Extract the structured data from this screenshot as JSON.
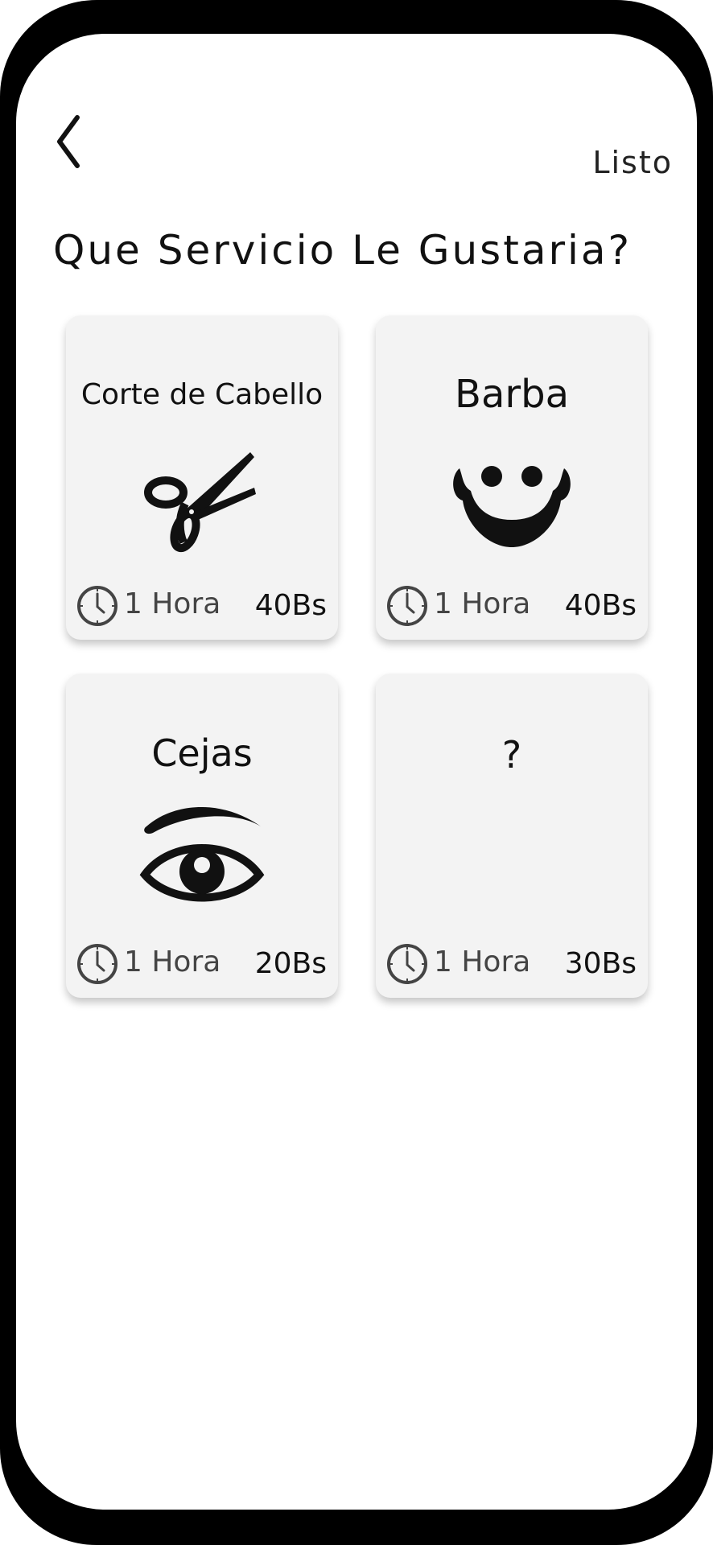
{
  "header": {
    "back_icon": "chevron-left-icon",
    "done_label": "Listo"
  },
  "page": {
    "title": "Que Servicio Le Gustaria?"
  },
  "services": [
    {
      "name": "Corte de Cabello",
      "icon": "scissors-icon",
      "duration": "1 Hora",
      "price": "40Bs"
    },
    {
      "name": "Barba",
      "icon": "beard-icon",
      "duration": "1 Hora",
      "price": "40Bs"
    },
    {
      "name": "Cejas",
      "icon": "eye-icon",
      "duration": "1 Hora",
      "price": "20Bs"
    },
    {
      "name": "?",
      "icon": "",
      "duration": "1 Hora",
      "price": "30Bs"
    }
  ],
  "colors": {
    "card_bg": "#f3f3f3",
    "device_frame": "#000000",
    "text_primary": "#111111"
  }
}
